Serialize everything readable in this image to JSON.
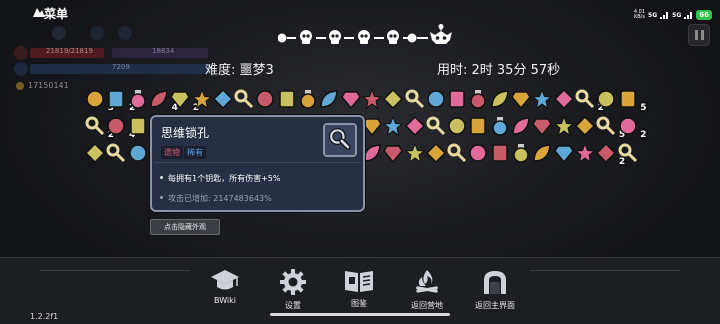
{
  "status_bar": {
    "speed_value": "4.01",
    "speed_unit": "KB/s",
    "signal1": "5G",
    "signal2": "5G",
    "battery": "66"
  },
  "hud": {
    "menu_label": "菜单",
    "hp_text": "21819/21819",
    "shield_text": "18834",
    "energy_text": "7209",
    "gold_text": "17150141"
  },
  "run_info": {
    "difficulty": "难度: 噩梦3",
    "play_time": "用时: 2时 35分 57秒"
  },
  "items": {
    "counts": [
      "3",
      "2",
      "",
      "4",
      "2",
      "",
      "",
      "",
      "",
      "",
      "",
      "",
      "",
      "",
      "",
      "",
      "",
      "",
      "",
      "",
      "",
      "",
      "",
      "2",
      "",
      "5",
      "2",
      "4",
      "5",
      "",
      "",
      "",
      "",
      "",
      "",
      "",
      "5",
      "",
      "",
      "",
      "",
      "",
      "",
      "",
      "",
      "",
      "",
      "",
      "",
      "",
      "5",
      "2",
      "",
      "",
      "",
      "",
      "",
      "",
      "",
      "",
      "",
      "",
      "",
      "",
      "",
      "",
      "",
      "",
      "",
      "",
      "",
      "",
      "",
      "",
      "",
      "",
      "2"
    ]
  },
  "tooltip": {
    "title": "思维锁孔",
    "tag_relic": "遗物",
    "tag_rarity": "稀有",
    "effect": "每拥有1个钥匙，所有伤害+5%",
    "bonus": "攻击已增加: 2147483643%"
  },
  "hide_button": "点击隐藏外观",
  "nav": {
    "bwiki": "BWiki",
    "settings": "设置",
    "codex": "图鉴",
    "return_camp": "返回营地",
    "return_main": "返回主界面"
  },
  "version": "1.2.2f1",
  "colors": {
    "tooltip_bg": "#272f44",
    "tooltip_border": "#8a93a8",
    "relic_tag": "#d65c7a",
    "rarity_tag": "#5aa0e8",
    "battery": "#2fc84a"
  }
}
